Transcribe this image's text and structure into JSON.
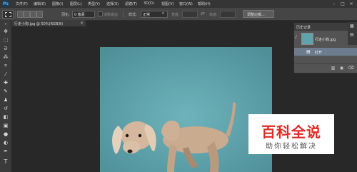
{
  "app": {
    "logo": "Ps"
  },
  "menu": [
    "文件(F)",
    "编辑(E)",
    "图像(I)",
    "图层(L)",
    "类型(Y)",
    "选择(S)",
    "滤镜(T)",
    "3D(D)",
    "视图(V)",
    "窗口(W)",
    "帮助(H)"
  ],
  "options": {
    "feather_label": "羽化:",
    "feather_value": "0 像素",
    "antialias_label": "消除锯齿",
    "style_label": "样式:",
    "style_value": "正常",
    "width_label": "宽度:",
    "height_label": "高度:",
    "refine_edge_button": "调整边缘..."
  },
  "document_tab": {
    "label": "行走小狗.jpg @ 50%(RGB/8)",
    "close": "×"
  },
  "history_panel": {
    "title": "历史记录",
    "snapshot_label": "行走小狗.jpg",
    "open_label": "打开"
  },
  "watermark": {
    "title": "百科全说",
    "subtitle": "助你轻松解决"
  },
  "colors": {
    "canvas_bg": "#5fa3ac",
    "watermark_red": "#df2a25"
  }
}
